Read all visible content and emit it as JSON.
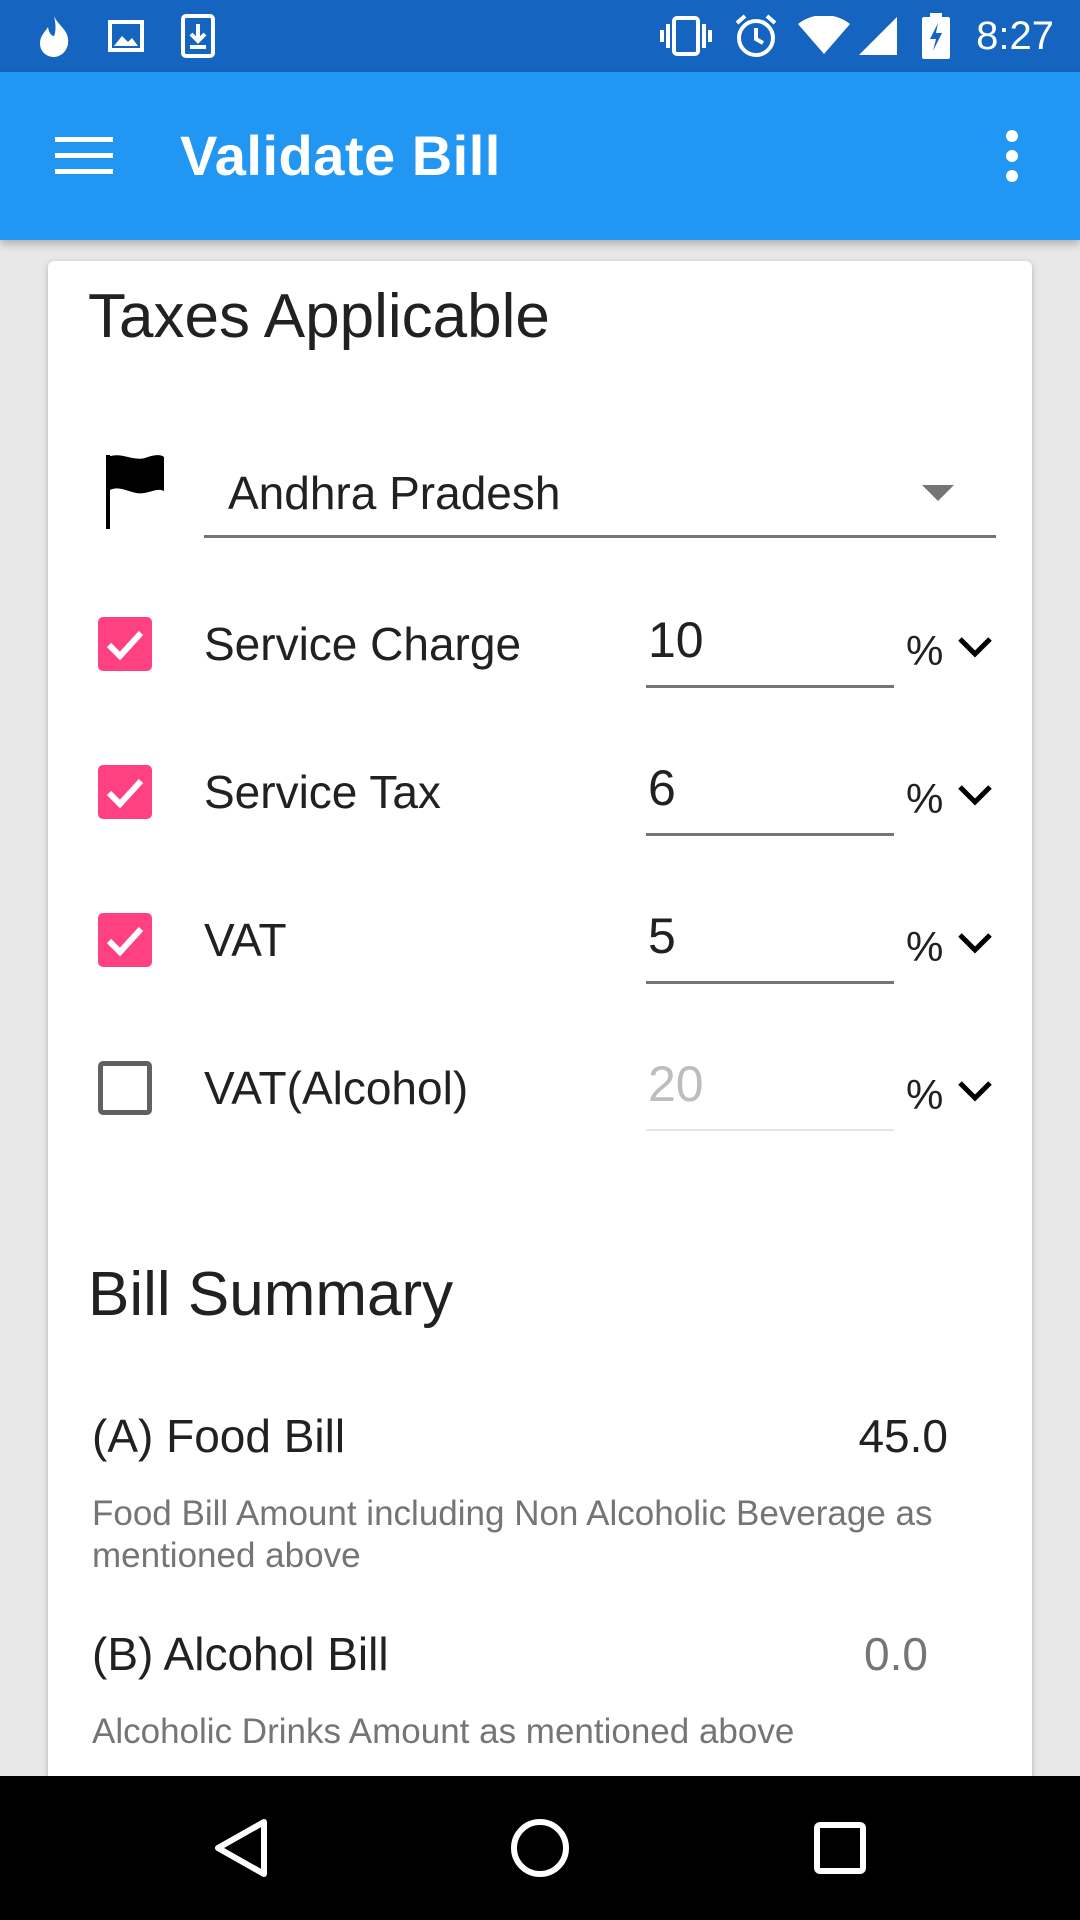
{
  "status_bar": {
    "time": "8:27",
    "icons": [
      "flame-icon",
      "image-icon",
      "download-icon",
      "vibrate-icon",
      "alarm-icon",
      "wifi-icon",
      "signal-icon",
      "battery-charging-icon"
    ]
  },
  "app_bar": {
    "title": "Validate Bill",
    "menu_icon": "hamburger-menu-icon",
    "overflow_icon": "more-vert-icon",
    "color": "#2196f3",
    "status_color": "#1565c0"
  },
  "taxes": {
    "title": "Taxes Applicable",
    "state": "Andhra Pradesh",
    "state_icon": "flag-icon",
    "rows": [
      {
        "label": "Service Charge",
        "value": "10",
        "checked": true,
        "unit": "%"
      },
      {
        "label": "Service Tax",
        "value": "6",
        "checked": true,
        "unit": "%"
      },
      {
        "label": "VAT",
        "value": "5",
        "checked": true,
        "unit": "%"
      },
      {
        "label": "VAT(Alcohol)",
        "value": "20",
        "checked": false,
        "unit": "%"
      }
    ],
    "accent": "#ff4081"
  },
  "summary": {
    "title": "Bill Summary",
    "food_label": "(A) Food Bill",
    "food_value": "45.0",
    "food_hint": "Food Bill Amount including Non Alcoholic Beverage as mentioned above",
    "alcohol_label": "(B) Alcohol Bill",
    "alcohol_value": "0.0",
    "alcohol_hint": "Alcoholic Drinks Amount as mentioned above"
  },
  "nav_bar": {
    "icons": [
      "back-icon",
      "home-icon",
      "recents-icon"
    ]
  }
}
